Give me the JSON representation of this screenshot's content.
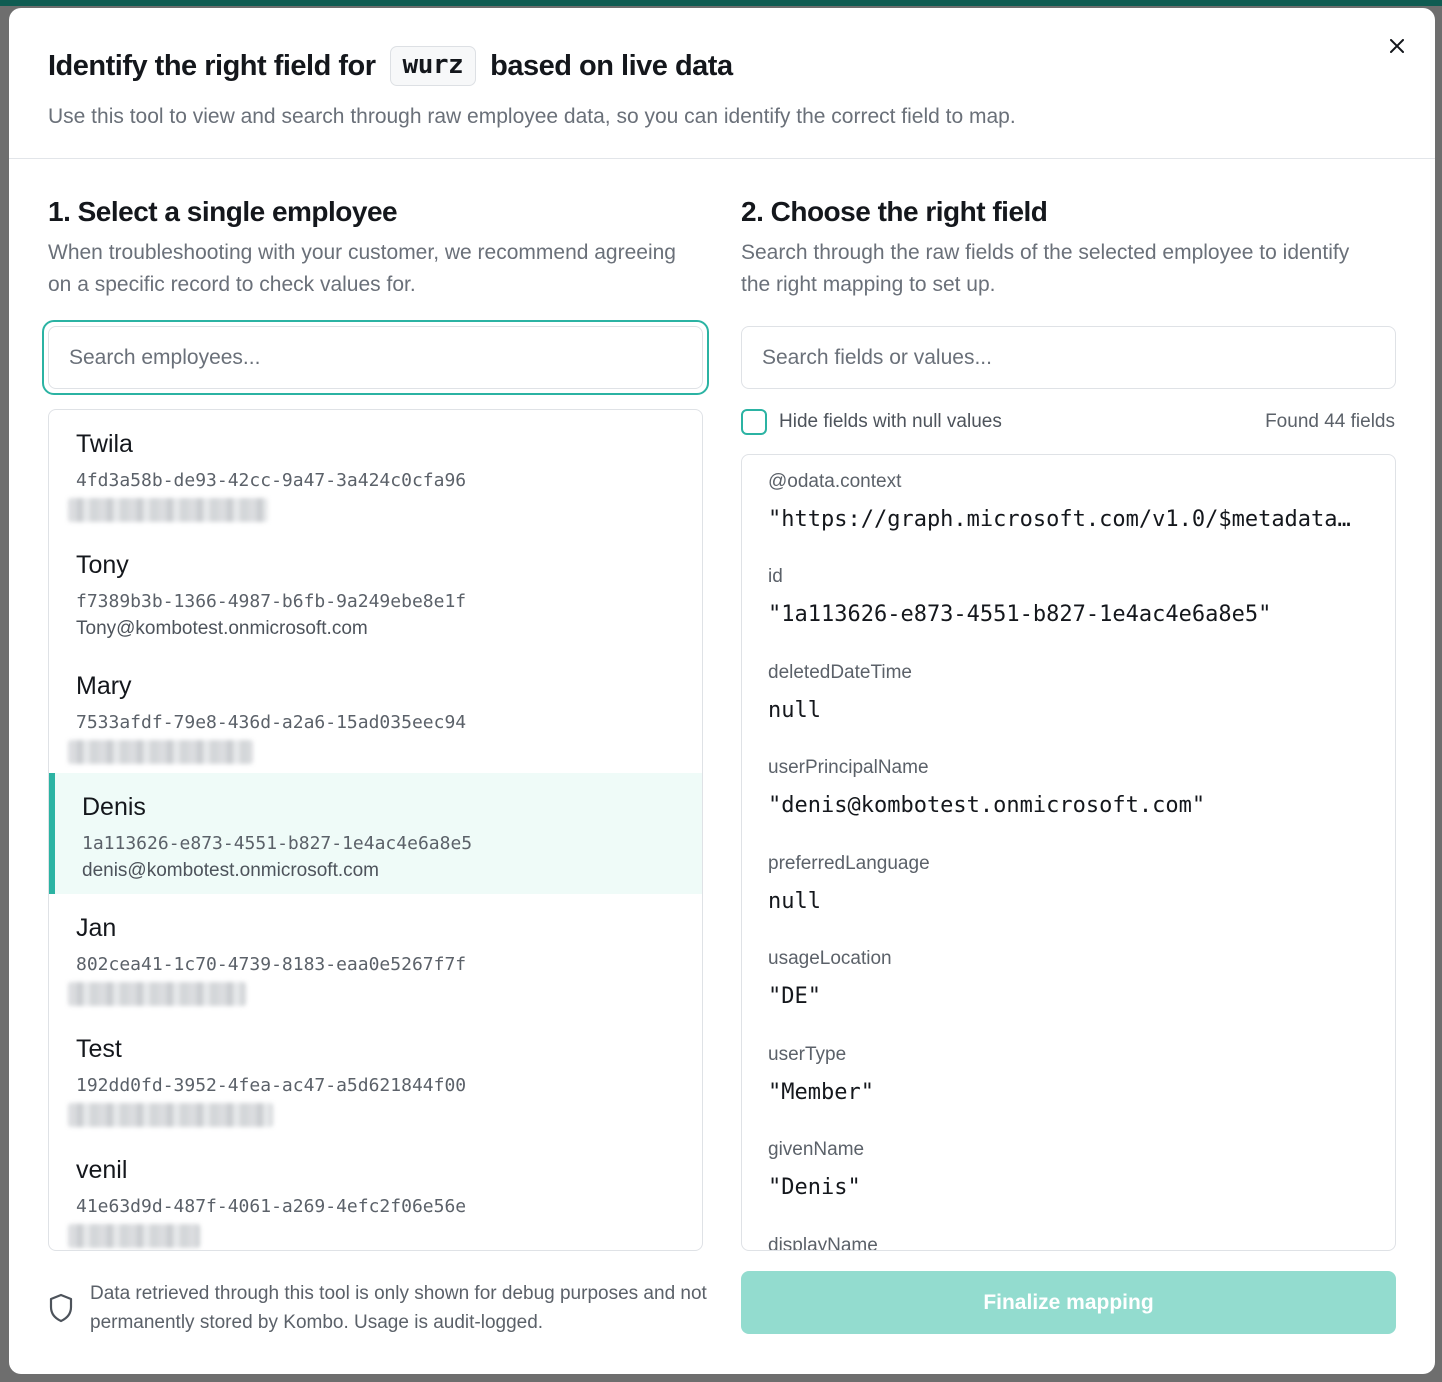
{
  "header": {
    "title_prefix": "Identify the right field for",
    "title_code": "wurz",
    "title_suffix": "based on live data",
    "subtitle": "Use this tool to view and search through raw employee data, so you can identify the correct field to map.",
    "close_icon": "close-icon"
  },
  "left": {
    "title": "1. Select a single employee",
    "description": "When troubleshooting with your customer, we recommend agreeing on a specific record to check values for.",
    "search_placeholder": "Search employees...",
    "employees": [
      {
        "name": "Twila",
        "id": "4fd3a58b-de93-42cc-9a47-3a424c0cfa96",
        "email": ""
      },
      {
        "name": "Tony",
        "id": "f7389b3b-1366-4987-b6fb-9a249ebe8e1f",
        "email": "Tony@kombotest.onmicrosoft.com"
      },
      {
        "name": "Mary",
        "id": "7533afdf-79e8-436d-a2a6-15ad035eec94",
        "email": ""
      },
      {
        "name": "Denis",
        "id": "1a113626-e873-4551-b827-1e4ac4e6a8e5",
        "email": "denis@kombotest.onmicrosoft.com",
        "selected": true
      },
      {
        "name": "Jan",
        "id": "802cea41-1c70-4739-8183-eaa0e5267f7f",
        "email": ""
      },
      {
        "name": "Test",
        "id": "192dd0fd-3952-4fea-ac47-a5d621844f00",
        "email": ""
      },
      {
        "name": "venil",
        "id": "41e63d9d-487f-4061-a269-4efc2f06e56e",
        "email": ""
      }
    ],
    "footer_note": "Data retrieved through this tool is only shown for debug purposes and not permanently stored by Kombo. Usage is audit-logged.",
    "footer_icon": "shield-icon"
  },
  "right": {
    "title": "2. Choose the right field",
    "description": "Search through the raw fields of the selected employee to identify the right mapping to set up.",
    "search_placeholder": "Search fields or values...",
    "checkbox_label": "Hide fields with null values",
    "found_text": "Found 44 fields",
    "fields": [
      {
        "key": "@odata.context",
        "value": "\"https://graph.microsoft.com/v1.0/$metadata…"
      },
      {
        "key": "id",
        "value": "\"1a113626-e873-4551-b827-1e4ac4e6a8e5\""
      },
      {
        "key": "deletedDateTime",
        "value": "null"
      },
      {
        "key": "userPrincipalName",
        "value": "\"denis@kombotest.onmicrosoft.com\""
      },
      {
        "key": "preferredLanguage",
        "value": "null"
      },
      {
        "key": "usageLocation",
        "value": "\"DE\""
      },
      {
        "key": "userType",
        "value": "\"Member\""
      },
      {
        "key": "givenName",
        "value": "\"Denis\""
      },
      {
        "key": "displayName",
        "value": ""
      }
    ],
    "finalize_label": "Finalize mapping"
  },
  "colors": {
    "accent": "#2bb3a3",
    "selected_bg": "#effbf8",
    "button_disabled": "#93dccf"
  }
}
